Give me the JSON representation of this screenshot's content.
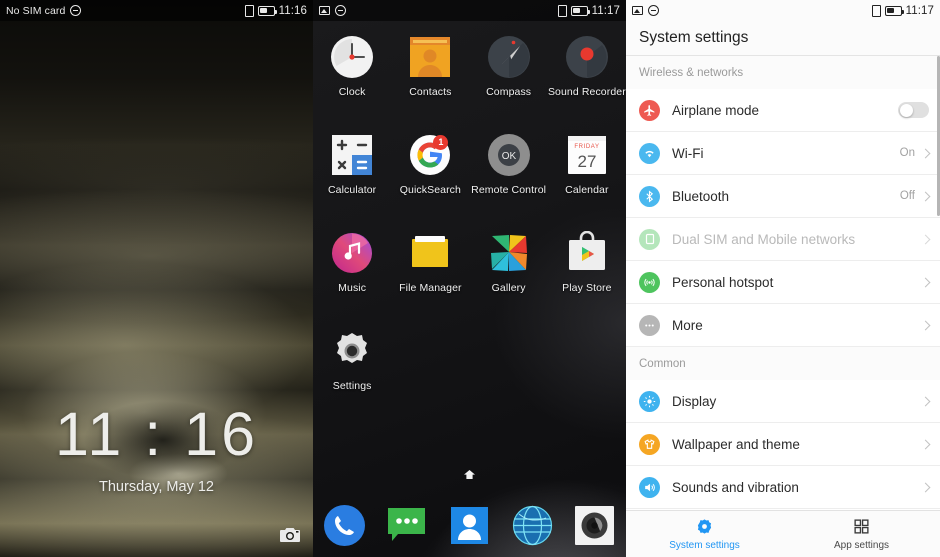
{
  "lockscreen": {
    "statusbar": {
      "carrier": "No SIM card",
      "left_icons": [
        "sim-card-icon",
        "no-alerts-circle-icon"
      ],
      "right_icons": [
        "screenshot-icon",
        "battery-icon"
      ],
      "time": "11:16"
    },
    "clock": "11 : 16",
    "date": "Thursday, May 12",
    "camera_shortcut": "camera-icon"
  },
  "drawer": {
    "statusbar": {
      "left_icons": [
        "screenshot-image-icon",
        "no-alerts-circle-icon"
      ],
      "right_icons": [
        "screenshot-icon",
        "battery-icon"
      ],
      "time": "11:17"
    },
    "apps": [
      {
        "label": "Clock",
        "icon": "clock-icon"
      },
      {
        "label": "Contacts",
        "icon": "contacts-icon"
      },
      {
        "label": "Compass",
        "icon": "compass-icon"
      },
      {
        "label": "Sound Recorder",
        "icon": "sound-recorder-icon"
      },
      {
        "label": "Calculator",
        "icon": "calculator-icon"
      },
      {
        "label": "QuickSearch",
        "icon": "google-icon",
        "badge": "1"
      },
      {
        "label": "Remote Control",
        "icon": "remote-control-icon",
        "icon_text": "OK"
      },
      {
        "label": "Calendar",
        "icon": "calendar-icon",
        "calendar_day_name": "FRIDAY",
        "calendar_date": "27"
      },
      {
        "label": "Music",
        "icon": "music-icon"
      },
      {
        "label": "File Manager",
        "icon": "file-manager-icon"
      },
      {
        "label": "Gallery",
        "icon": "gallery-icon"
      },
      {
        "label": "Play Store",
        "icon": "play-store-icon"
      },
      {
        "label": "Settings",
        "icon": "settings-gear-icon"
      }
    ],
    "page_indicator": "home-indicator-icon",
    "dock": [
      {
        "name": "phone-icon"
      },
      {
        "name": "messaging-icon"
      },
      {
        "name": "people-icon"
      },
      {
        "name": "browser-icon"
      },
      {
        "name": "camera-app-icon"
      }
    ]
  },
  "settings": {
    "statusbar": {
      "left_icons": [
        "screenshot-image-icon",
        "no-alerts-circle-icon"
      ],
      "right_icons": [
        "screenshot-icon",
        "battery-icon"
      ],
      "time": "11:17"
    },
    "title": "System settings",
    "sections": [
      {
        "header": "Wireless & networks",
        "rows": [
          {
            "label": "Airplane mode",
            "icon": "airplane-icon",
            "icon_color": "#ee5a52",
            "control": "toggle",
            "toggle_on": false
          },
          {
            "label": "Wi-Fi",
            "icon": "wifi-icon",
            "icon_color": "#4ab8ef",
            "value": "On",
            "control": "chevron"
          },
          {
            "label": "Bluetooth",
            "icon": "bluetooth-icon",
            "icon_color": "#4ab8ef",
            "value": "Off",
            "control": "chevron"
          },
          {
            "label": "Dual SIM and Mobile networks",
            "icon": "sim-card-icon",
            "icon_color": "#4ec45e",
            "control": "chevron",
            "disabled": true
          },
          {
            "label": "Personal hotspot",
            "icon": "hotspot-icon",
            "icon_color": "#4ec45e",
            "control": "chevron"
          },
          {
            "label": "More",
            "icon": "more-dots-icon",
            "icon_color": "#b6b6b6",
            "control": "chevron"
          }
        ]
      },
      {
        "header": "Common",
        "rows": [
          {
            "label": "Display",
            "icon": "brightness-icon",
            "icon_color": "#3fb3ef",
            "control": "chevron"
          },
          {
            "label": "Wallpaper and theme",
            "icon": "tshirt-icon",
            "icon_color": "#f5a623",
            "control": "chevron"
          },
          {
            "label": "Sounds and vibration",
            "icon": "speaker-icon",
            "icon_color": "#3fb3ef",
            "control": "chevron"
          }
        ]
      }
    ],
    "tabs": [
      {
        "label": "System settings",
        "icon": "gear-icon",
        "active": true
      },
      {
        "label": "App settings",
        "icon": "grid-icon",
        "active": false
      }
    ],
    "accent_color": "#2196f3"
  }
}
